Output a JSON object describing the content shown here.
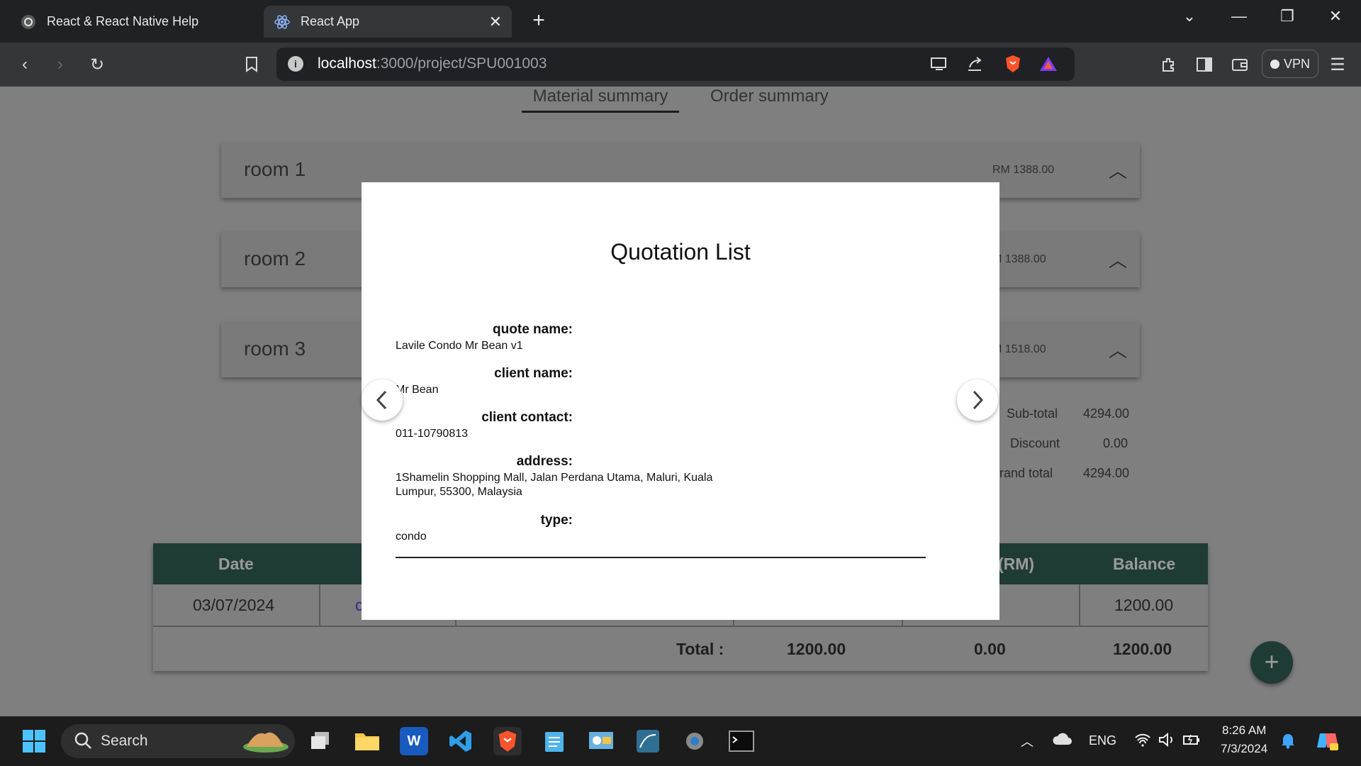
{
  "browser": {
    "tabs": [
      {
        "title": "React & React Native Help",
        "active": false,
        "icon": "openai-icon"
      },
      {
        "title": "React App",
        "active": true,
        "icon": "react-icon"
      }
    ],
    "url_host": "localhost",
    "url_rest": ":3000/project/SPU001003",
    "vpn_label": "VPN"
  },
  "page": {
    "tabs": [
      "Material summary",
      "Order summary"
    ],
    "rooms": [
      {
        "name": "room 1",
        "price": "RM 1388.00"
      },
      {
        "name": "room 2",
        "price": "M 1388.00"
      },
      {
        "name": "room 3",
        "price": "M 1518.00"
      }
    ],
    "summary": {
      "subtotal_label": "Sub-total",
      "subtotal_value": "4294.00",
      "discount_label": "Discount",
      "discount_value": "0.00",
      "grand_label": "Grand total",
      "grand_value": "4294.00"
    },
    "table": {
      "headers": {
        "date": "Date",
        "rm": "(RM)",
        "balance": "Balance"
      },
      "row": {
        "date": "03/07/2024",
        "partial": "c",
        "balance": "1200.00"
      },
      "total": {
        "label": "Total :",
        "amount": "1200.00",
        "paid": "0.00",
        "balance": "1200.00"
      }
    },
    "fab_label": "+"
  },
  "modal": {
    "title": "Quotation List",
    "fields": [
      {
        "label": "quote name:",
        "value": "Lavile Condo Mr Bean v1"
      },
      {
        "label": "client name:",
        "value": "Mr Bean"
      },
      {
        "label": "client contact:",
        "value": "011-10790813"
      },
      {
        "label": "address:",
        "value_line1": "1Shamelin Shopping Mall, Jalan Perdana Utama, Maluri, Kuala",
        "value_line2": "Lumpur, 55300, Malaysia"
      },
      {
        "label": "type:",
        "value": "condo"
      }
    ]
  },
  "taskbar": {
    "search_placeholder": "Search",
    "lang": "ENG",
    "time": "8:26 AM",
    "date": "7/3/2024"
  },
  "colors": {
    "table_header": "#1f3b36",
    "overlay": "#7f7f7f",
    "modal_bg": "#ffffff"
  }
}
